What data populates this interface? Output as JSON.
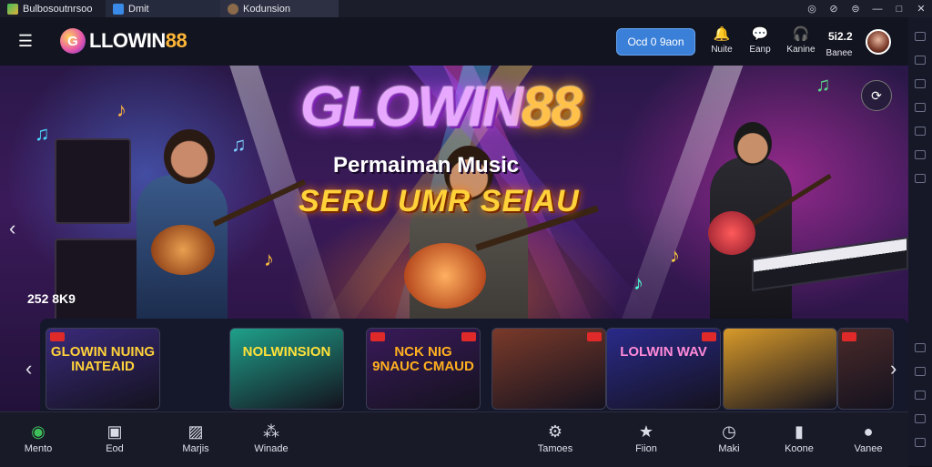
{
  "tabstrip": {
    "tabs": [
      {
        "label": "Bulbosoutnrsoo"
      },
      {
        "label": "Dmit"
      },
      {
        "label": "Kodunsion"
      }
    ],
    "controls": [
      "◎",
      "⊘",
      "⊜",
      "—",
      "□",
      "✕"
    ]
  },
  "header": {
    "logo": {
      "mark": "G",
      "prefix": "LLOWIN",
      "number": "88"
    },
    "login_label": "Ocd 0 9aon",
    "nav": [
      {
        "icon": "bell-icon",
        "glyph": "🔔",
        "label": "Nuite"
      },
      {
        "icon": "chat-icon",
        "glyph": "💬",
        "label": "Eanp"
      },
      {
        "icon": "headset-icon",
        "glyph": "🎧",
        "label": "Kanine"
      }
    ],
    "number_text": "5i2.2",
    "number_label": "Banee"
  },
  "hero": {
    "title_prefix": "GLOWIN",
    "title_number": "88",
    "subtitle": "Permaiman Music",
    "tagline": "SERU UMR SEIAU",
    "count_text": "252 8K9",
    "prev_arrow": "‹",
    "next_arrow": "›"
  },
  "games": {
    "prev_arrow": "‹",
    "next_arrow": "›",
    "cards": [
      {
        "label": "GLOWIN NUING INATEAID",
        "bg": "#3a2a7a",
        "fg": "#ffd23a"
      },
      {
        "label": "NOLWINSION",
        "bg": "#1fa08a",
        "fg": "#ffe23a"
      },
      {
        "label": "NCK NIG 9NAUC CMAUD",
        "bg": "#3a1a5a",
        "fg": "#ffb020"
      },
      {
        "label": "",
        "bg": "#7a3a2a",
        "fg": "#ffffff"
      },
      {
        "label": "LOLWIN WAV",
        "bg": "#2a2a8a",
        "fg": "#ff8ad8"
      },
      {
        "label": "",
        "bg": "#d89a2a",
        "fg": "#ffffff"
      },
      {
        "label": "",
        "bg": "#4a2a2a",
        "fg": "#ffffff"
      }
    ]
  },
  "bottom_nav": [
    {
      "icon": "home-icon",
      "glyph": "◉",
      "label": "Mento"
    },
    {
      "icon": "food-icon",
      "glyph": "▣",
      "label": "Eod"
    },
    {
      "icon": "image-icon",
      "glyph": "▨",
      "label": "Marjis"
    },
    {
      "icon": "share-icon",
      "glyph": "⁂",
      "label": "Winade"
    },
    {
      "icon": "settings-icon",
      "glyph": "⚙",
      "label": "Tamoes"
    },
    {
      "icon": "star-icon",
      "glyph": "★",
      "label": "Fiion"
    },
    {
      "icon": "clock-icon",
      "glyph": "◷",
      "label": "Maki"
    },
    {
      "icon": "phone-icon",
      "glyph": "▮",
      "label": "Koone"
    },
    {
      "icon": "user-icon",
      "glyph": "●",
      "label": "Vanee"
    }
  ]
}
